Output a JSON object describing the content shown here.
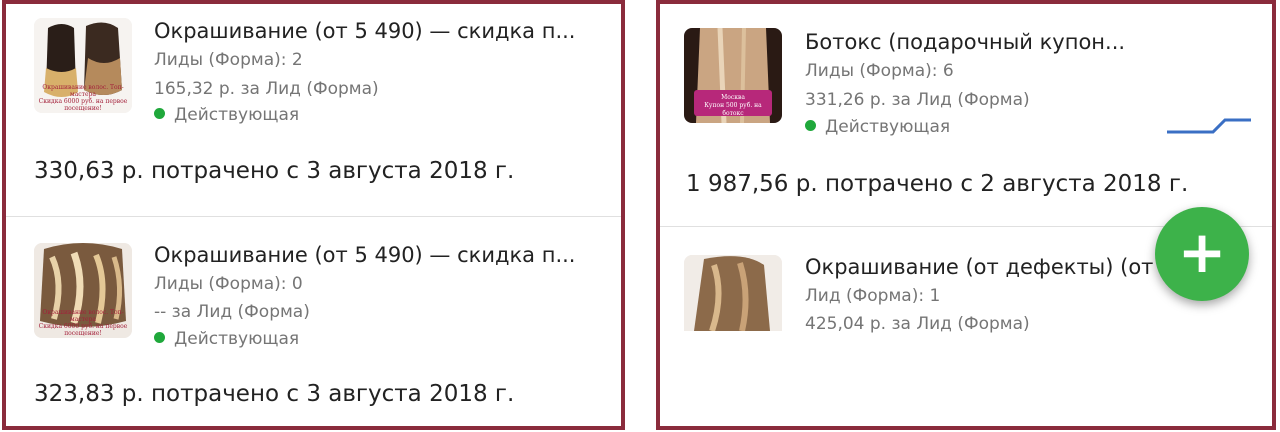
{
  "left_panel": {
    "ads": [
      {
        "title": "Окрашивание (от 5 490) — скидка п...",
        "leads": "Лиды (Форма): 2",
        "cost_per_lead": "165,32 р. за Лид (Форма)",
        "status": "Действующая",
        "spent": "330,63 р. потрачено с 3 августа 2018 г.",
        "thumb_caption_1": "Окрашивание волос. Топ-мастера",
        "thumb_caption_2": "Скидка 6000 руб. на первое посещение!"
      },
      {
        "title": "Окрашивание (от 5 490) — скидка п...",
        "leads": "Лиды (Форма): 0",
        "cost_per_lead": "-- за Лид (Форма)",
        "status": "Действующая",
        "spent": "323,83 р. потрачено с 3 августа 2018 г.",
        "thumb_caption_1": "Окрашивание волос. Топ-мастера",
        "thumb_caption_2": "Скидка 6000 руб. на первое посещение!"
      }
    ]
  },
  "right_panel": {
    "ads": [
      {
        "title": "Ботокс (подарочный купон...",
        "leads": "Лиды (Форма): 6",
        "cost_per_lead": "331,26 р. за Лид (Форма)",
        "status": "Действующая",
        "spent": "1 987,56 р. потрачено с 2 августа 2018 г.",
        "thumb_caption_1": "Москва",
        "thumb_caption_2": "Купон 500 руб. на ботокс"
      },
      {
        "title": "Окрашивание (от дефекты) (от",
        "leads": "Лид (Форма): 1",
        "cost_per_lead": "425,04 р. за Лид (Форма)"
      }
    ],
    "fab_icon": "plus-icon",
    "fab_label": "+"
  },
  "colors": {
    "frame": "#8a2b3c",
    "status_active": "#1fa83b",
    "fab": "#3db24a",
    "sparkline": "#3a6fc4"
  }
}
